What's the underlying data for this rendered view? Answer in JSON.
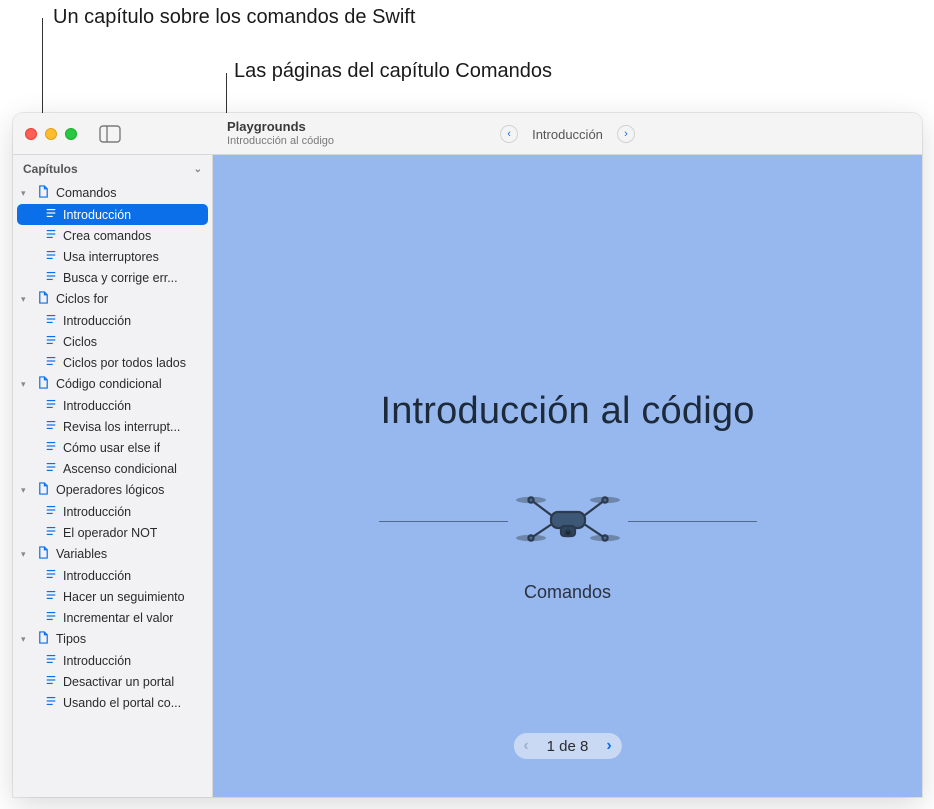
{
  "callouts": {
    "chapter": "Un capítulo sobre los comandos de Swift",
    "pages": "Las páginas del capítulo Comandos"
  },
  "titlebar": {
    "appTitle": "Playgrounds",
    "subtitle": "Introducción al código",
    "currentPage": "Introducción"
  },
  "sidebar": {
    "header": "Capítulos",
    "chapters": [
      {
        "label": "Comandos",
        "pages": [
          {
            "label": "Introducción",
            "selected": true
          },
          {
            "label": "Crea comandos"
          },
          {
            "label": "Usa interruptores"
          },
          {
            "label": "Busca y corrige err..."
          }
        ]
      },
      {
        "label": "Ciclos for",
        "pages": [
          {
            "label": "Introducción"
          },
          {
            "label": "Ciclos"
          },
          {
            "label": "Ciclos por todos lados"
          }
        ]
      },
      {
        "label": "Código condicional",
        "pages": [
          {
            "label": "Introducción"
          },
          {
            "label": "Revisa los interrupt..."
          },
          {
            "label": "Cómo usar else if"
          },
          {
            "label": "Ascenso condicional"
          }
        ]
      },
      {
        "label": "Operadores lógicos",
        "pages": [
          {
            "label": "Introducción"
          },
          {
            "label": "El operador NOT"
          }
        ]
      },
      {
        "label": "Variables",
        "pages": [
          {
            "label": "Introducción"
          },
          {
            "label": "Hacer un seguimiento"
          },
          {
            "label": "Incrementar el valor"
          }
        ]
      },
      {
        "label": "Tipos",
        "pages": [
          {
            "label": "Introducción"
          },
          {
            "label": "Desactivar un portal"
          },
          {
            "label": "Usando el portal co..."
          }
        ]
      }
    ]
  },
  "content": {
    "title": "Introducción al código",
    "subtitle": "Comandos",
    "pager": "1 de 8"
  }
}
